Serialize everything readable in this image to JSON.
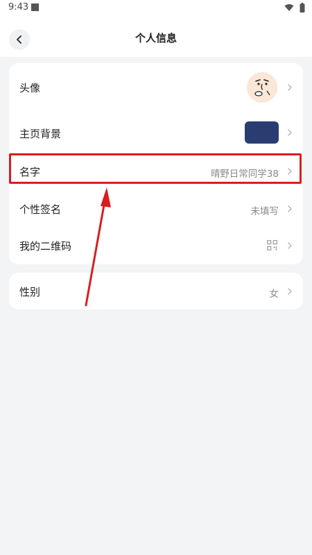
{
  "status_bar": {
    "time": "9:43"
  },
  "header": {
    "title": "个人信息"
  },
  "profile": {
    "avatar_label": "头像",
    "background_label": "主页背景",
    "name_label": "名字",
    "name_value": "晴野日常同学38",
    "signature_label": "个性签名",
    "signature_value": "未填写",
    "qrcode_label": "我的二维码"
  },
  "gender": {
    "label": "性别",
    "value": "女"
  },
  "colors": {
    "page_bg": "#f3f4f6",
    "card_bg": "#ffffff",
    "highlight": "#d81e1e",
    "theme_thumb": "#2a3d72"
  }
}
